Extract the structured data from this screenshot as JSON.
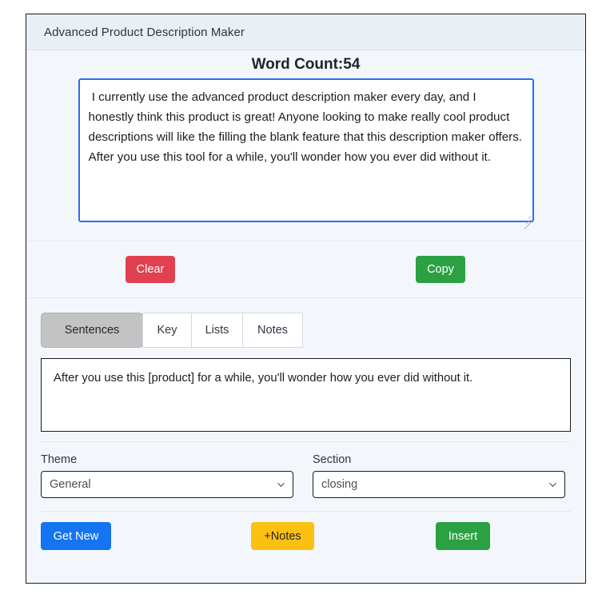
{
  "window": {
    "header_title": "Advanced Product Description Maker"
  },
  "word_count": {
    "label": "Word Count:54"
  },
  "editor": {
    "value": " I currently use the advanced product description maker every day, and I honestly think this product is great! Anyone looking to make really cool product descriptions will like the filling the blank feature that this description maker offers. After you use this tool for a while, you'll wonder how you ever did without it.",
    "placeholder": ""
  },
  "actions": {
    "clear_label": "Clear",
    "copy_label": "Copy"
  },
  "tabs": [
    {
      "label": "Sentences",
      "active": true
    },
    {
      "label": "Key",
      "active": false
    },
    {
      "label": "Lists",
      "active": false
    },
    {
      "label": "Notes",
      "active": false
    }
  ],
  "sentence_preview": {
    "text": "After you use this [product] for a while, you'll wonder how you ever did without it."
  },
  "theme_field": {
    "label": "Theme",
    "value": "General",
    "options": [
      "General"
    ]
  },
  "section_field": {
    "label": "Section",
    "value": "closing",
    "options": [
      "closing"
    ]
  },
  "bottom_actions": {
    "get_new_label": "Get New",
    "notes_label": "+Notes",
    "insert_label": "Insert"
  },
  "colors": {
    "clear_red": "#e0404f",
    "copy_green": "#2ba144",
    "get_new_blue": "#1575f0",
    "notes_amber": "#fbc012",
    "insert_green": "#2ba144",
    "card_background": "#f3f7fc",
    "header_background": "#eaeff6",
    "focus_border": "#2d6df6",
    "active_tab": "#c3c3c3"
  }
}
